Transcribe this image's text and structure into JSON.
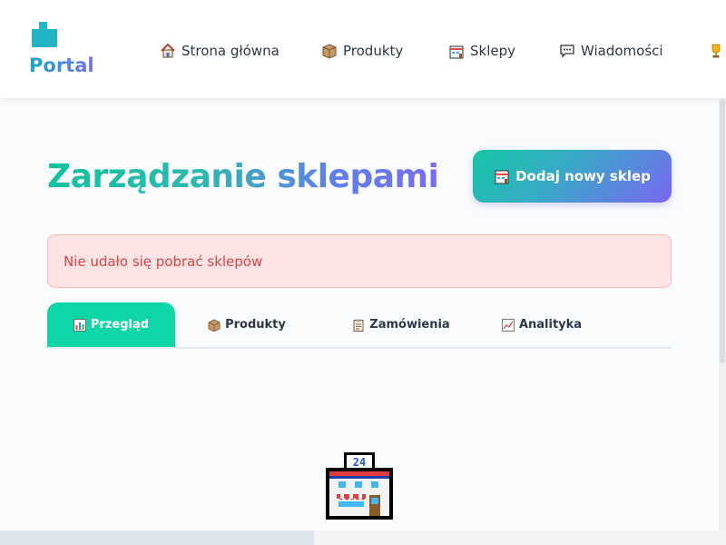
{
  "brand": {
    "name": "Portal"
  },
  "nav": {
    "items": [
      {
        "label": "Strona główna",
        "icon": "house-icon"
      },
      {
        "label": "Produkty",
        "icon": "package-icon"
      },
      {
        "label": "Sklepy",
        "icon": "store-icon"
      },
      {
        "label": "Wiadomości",
        "icon": "speech-bubble-icon"
      },
      {
        "label": "",
        "icon": "trophy-icon"
      }
    ]
  },
  "page": {
    "title": "Zarządzanie sklepami",
    "add_button_label": "Dodaj nowy sklep",
    "error_message": "Nie udało się pobrać sklepów"
  },
  "tabs": [
    {
      "label": "Przegląd",
      "icon": "bar-chart-icon",
      "active": true
    },
    {
      "label": "Produkty",
      "icon": "package-icon",
      "active": false
    },
    {
      "label": "Zamówienia",
      "icon": "clipboard-icon",
      "active": false
    },
    {
      "label": "Analityka",
      "icon": "line-chart-icon",
      "active": false
    }
  ],
  "illustration": {
    "icon": "convenience-store-icon",
    "sign_text": "24"
  },
  "colors": {
    "accent_teal": "#0fd6a6",
    "accent_purple": "#7a66f2",
    "error_text": "#d64545",
    "error_bg": "#fde3e3"
  }
}
